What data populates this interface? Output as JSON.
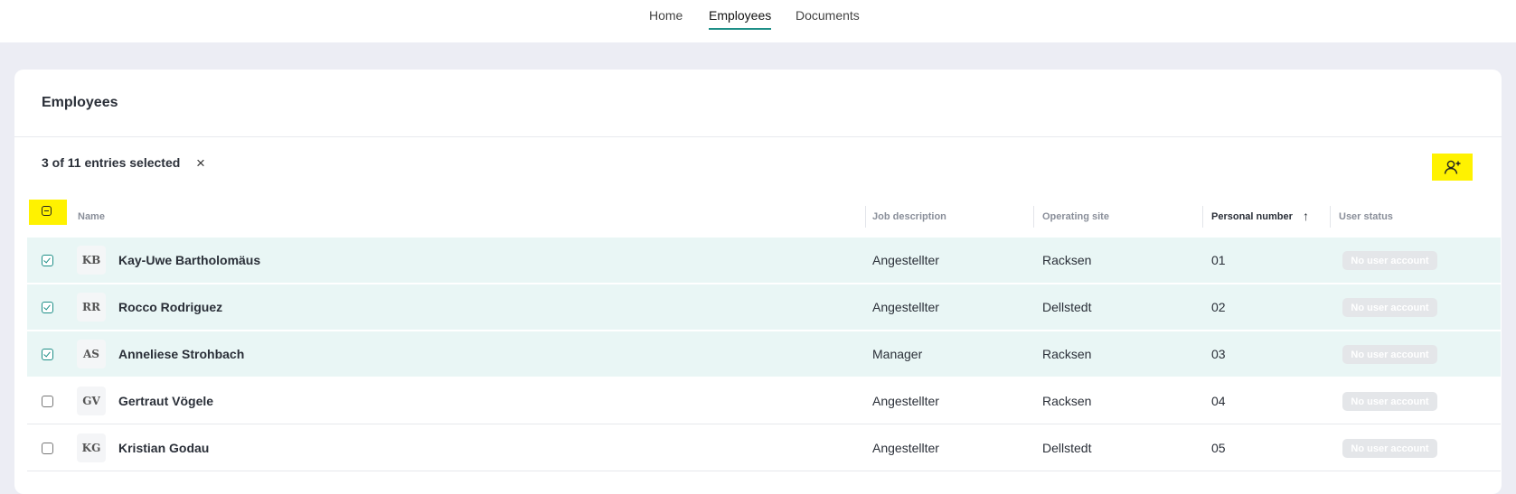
{
  "nav": {
    "tabs": [
      {
        "label": "Home"
      },
      {
        "label": "Employees"
      },
      {
        "label": "Documents"
      }
    ]
  },
  "card": {
    "title": "Employees",
    "selection_text": "3 of 11 entries selected",
    "clear_icon": "×"
  },
  "table": {
    "columns": {
      "name": "Name",
      "job": "Job description",
      "site": "Operating site",
      "number": "Personal number",
      "status": "User status"
    },
    "sort_icon": "↑",
    "rows": [
      {
        "initials": "KB",
        "name": "Kay-Uwe Bartholomäus",
        "job": "Angestellter",
        "site": "Racksen",
        "number": "01",
        "status": "No user account",
        "selected": true
      },
      {
        "initials": "RR",
        "name": "Rocco Rodriguez",
        "job": "Angestellter",
        "site": "Dellstedt",
        "number": "02",
        "status": "No user account",
        "selected": true
      },
      {
        "initials": "AS",
        "name": "Anneliese Strohbach",
        "job": "Manager",
        "site": "Racksen",
        "number": "03",
        "status": "No user account",
        "selected": true
      },
      {
        "initials": "GV",
        "name": "Gertraut Vögele",
        "job": "Angestellter",
        "site": "Racksen",
        "number": "04",
        "status": "No user account",
        "selected": false
      },
      {
        "initials": "KG",
        "name": "Kristian Godau",
        "job": "Angestellter",
        "site": "Dellstedt",
        "number": "05",
        "status": "No user account",
        "selected": false
      }
    ]
  },
  "colors": {
    "accent": "#1e8f87",
    "highlight": "#fff200",
    "selected_row": "#e9f6f5"
  }
}
